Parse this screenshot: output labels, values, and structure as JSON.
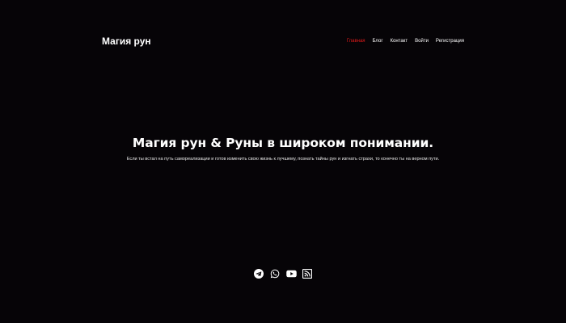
{
  "site": {
    "logo": "Магия рун"
  },
  "nav": {
    "items": [
      {
        "label": "Главная",
        "active": true
      },
      {
        "label": "Блог",
        "active": false
      },
      {
        "label": "Контакт",
        "active": false
      },
      {
        "label": "Войти",
        "active": false
      },
      {
        "label": "Регистрация",
        "active": false
      }
    ]
  },
  "hero": {
    "title": "Магия рун  &  Руны в широком понимании.",
    "subtitle": "Если ты встал на путь самореализации и готов изменить свою жизнь к лучшему, познать тайны рун и изгнать страхи, то конечно ты на верном пути."
  },
  "social": {
    "icons": [
      "telegram-icon",
      "whatsapp-icon",
      "youtube-icon",
      "rss-icon"
    ]
  },
  "colors": {
    "background": "#060407",
    "text": "#ffffff",
    "accent": "#e11a1a"
  }
}
